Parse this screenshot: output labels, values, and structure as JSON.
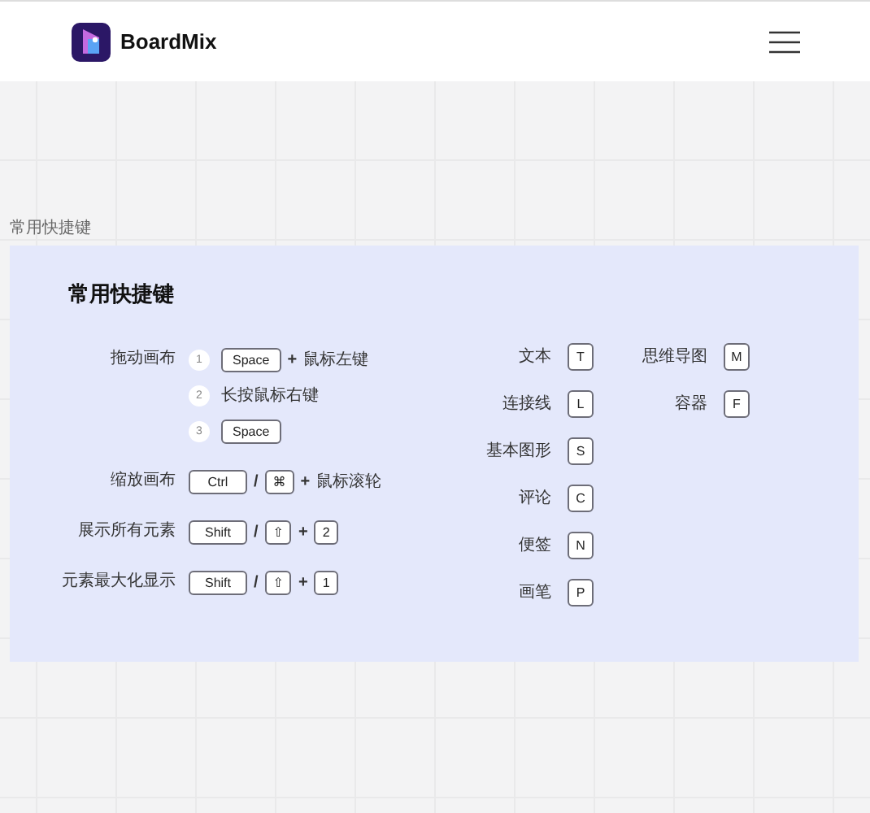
{
  "header": {
    "brand": "BoardMix"
  },
  "section_label": "常用快捷键",
  "card": {
    "title": "常用快捷键",
    "left_shortcuts": [
      {
        "label": "拖动画布",
        "lines": [
          {
            "number": "1",
            "parts": [
              {
                "kind": "key",
                "text": "Space"
              },
              {
                "kind": "op",
                "text": "+"
              },
              {
                "kind": "text",
                "text": "鼠标左键"
              }
            ]
          },
          {
            "number": "2",
            "parts": [
              {
                "kind": "text",
                "text": "长按鼠标右键"
              }
            ]
          },
          {
            "number": "3",
            "parts": [
              {
                "kind": "key",
                "text": "Space"
              }
            ]
          }
        ]
      },
      {
        "label": "缩放画布",
        "lines": [
          {
            "parts": [
              {
                "kind": "key",
                "text": "Ctrl"
              },
              {
                "kind": "op",
                "text": "/"
              },
              {
                "kind": "key",
                "text": "⌘"
              },
              {
                "kind": "op",
                "text": "+"
              },
              {
                "kind": "text",
                "text": "鼠标滚轮"
              }
            ]
          }
        ]
      },
      {
        "label": "展示所有元素",
        "lines": [
          {
            "parts": [
              {
                "kind": "key",
                "text": "Shift"
              },
              {
                "kind": "op",
                "text": "/"
              },
              {
                "kind": "key",
                "text": "⇧"
              },
              {
                "kind": "op",
                "text": "+"
              },
              {
                "kind": "key",
                "text": "2"
              }
            ]
          }
        ]
      },
      {
        "label": "元素最大化显示",
        "lines": [
          {
            "parts": [
              {
                "kind": "key",
                "text": "Shift"
              },
              {
                "kind": "op",
                "text": "/"
              },
              {
                "kind": "key",
                "text": "⇧"
              },
              {
                "kind": "op",
                "text": "+"
              },
              {
                "kind": "key",
                "text": "1"
              }
            ]
          }
        ]
      }
    ],
    "tool_columns": [
      [
        {
          "label": "文本",
          "key": "T"
        },
        {
          "label": "连接线",
          "key": "L"
        },
        {
          "label": "基本图形",
          "key": "S"
        },
        {
          "label": "评论",
          "key": "C"
        },
        {
          "label": "便签",
          "key": "N"
        },
        {
          "label": "画笔",
          "key": "P"
        }
      ],
      [
        {
          "label": "思维导图",
          "key": "M"
        },
        {
          "label": "容器",
          "key": "F"
        }
      ]
    ]
  }
}
